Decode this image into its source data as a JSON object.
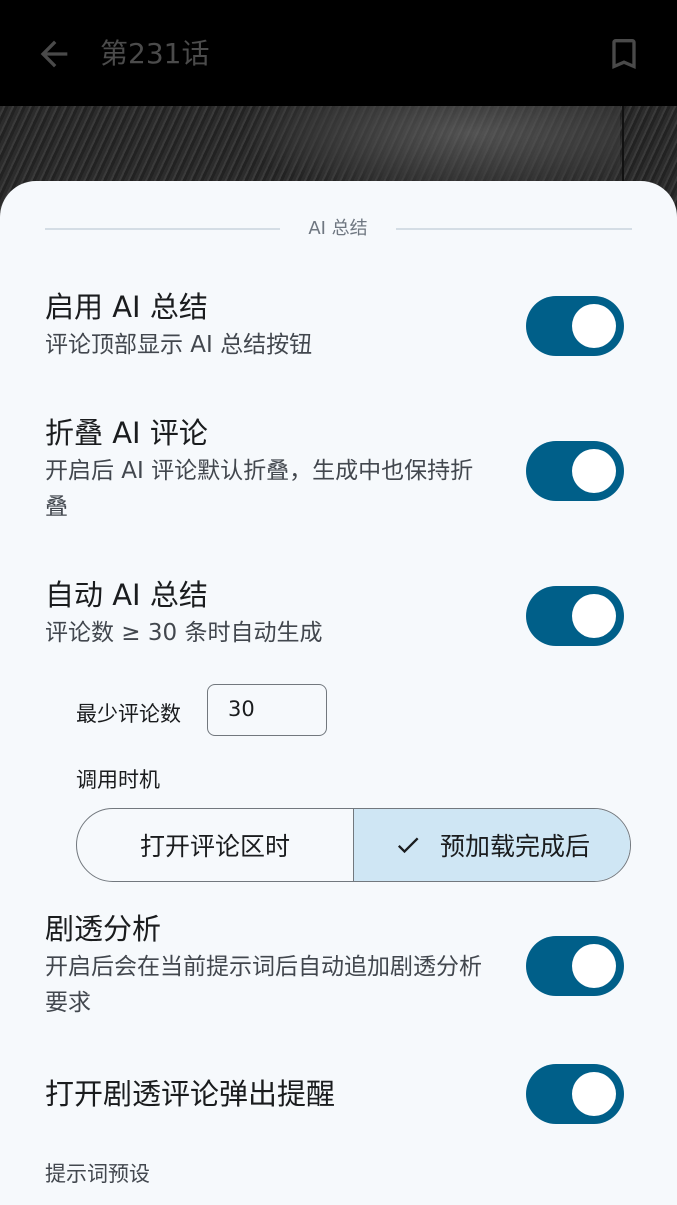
{
  "appbar": {
    "title": "第231话",
    "back_icon": "arrow-back-icon",
    "bookmark_icon": "bookmark-icon"
  },
  "sheet": {
    "section_header": "AI 总结",
    "settings": [
      {
        "title": "启用 AI 总结",
        "desc": "评论顶部显示 AI 总结按钮",
        "enabled": true
      },
      {
        "title": "折叠 AI 评论",
        "desc": "开启后 AI 评论默认折叠，生成中也保持折叠",
        "enabled": true
      },
      {
        "title": "自动 AI 总结",
        "desc": "评论数 ≥ 30 条时自动生成",
        "enabled": true
      },
      {
        "title": "剧透分析",
        "desc": "开启后会在当前提示词后自动追加剧透分析要求",
        "enabled": true
      },
      {
        "title": "打开剧透评论弹出提醒",
        "desc": "",
        "enabled": true
      }
    ],
    "min_comments": {
      "label": "最少评论数",
      "value": "30"
    },
    "timing": {
      "label": "调用时机",
      "options": [
        "打开评论区时",
        "预加载完成后"
      ],
      "selected": "预加载完成后"
    },
    "preset_label": "提示词预设"
  },
  "colors": {
    "toggle_on": "#005f89",
    "sheet_bg": "#f6f9fc",
    "segment_selected": "#cfe6f4"
  }
}
